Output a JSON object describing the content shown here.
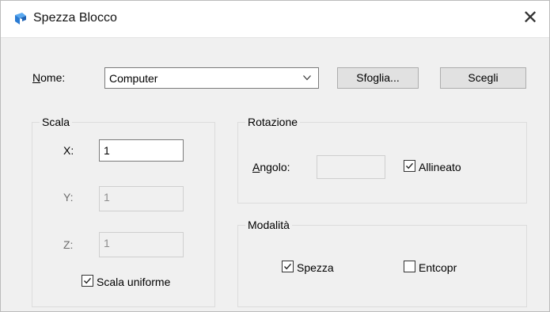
{
  "window": {
    "title": "Spezza Blocco",
    "close_glyph": "✕",
    "icon": "app-logo-icon"
  },
  "name_row": {
    "label_mnemonic": "N",
    "label_rest": "ome:",
    "value": "Computer",
    "browse_label": "Sfoglia...",
    "pick_label": "Scegli"
  },
  "scale": {
    "title": "Scala",
    "x_label": "X:",
    "x_value": "1",
    "y_label": "Y:",
    "y_value": "1",
    "z_label": "Z:",
    "z_value": "1",
    "uniform_label": "Scala uniforme",
    "uniform_checked": true
  },
  "rotation": {
    "title": "Rotazione",
    "angle_mnemonic": "A",
    "angle_rest": "ngolo:",
    "angle_value": "",
    "aligned_label": "Allineato",
    "aligned_checked": true
  },
  "mode": {
    "title": "Modalità",
    "split_label": "Spezza",
    "split_checked": true,
    "entcopy_label": "Entcopr",
    "entcopy_checked": false
  },
  "colors": {
    "dialog_bg": "#f0f0f0",
    "icon_blue": "#3a8ee6"
  }
}
